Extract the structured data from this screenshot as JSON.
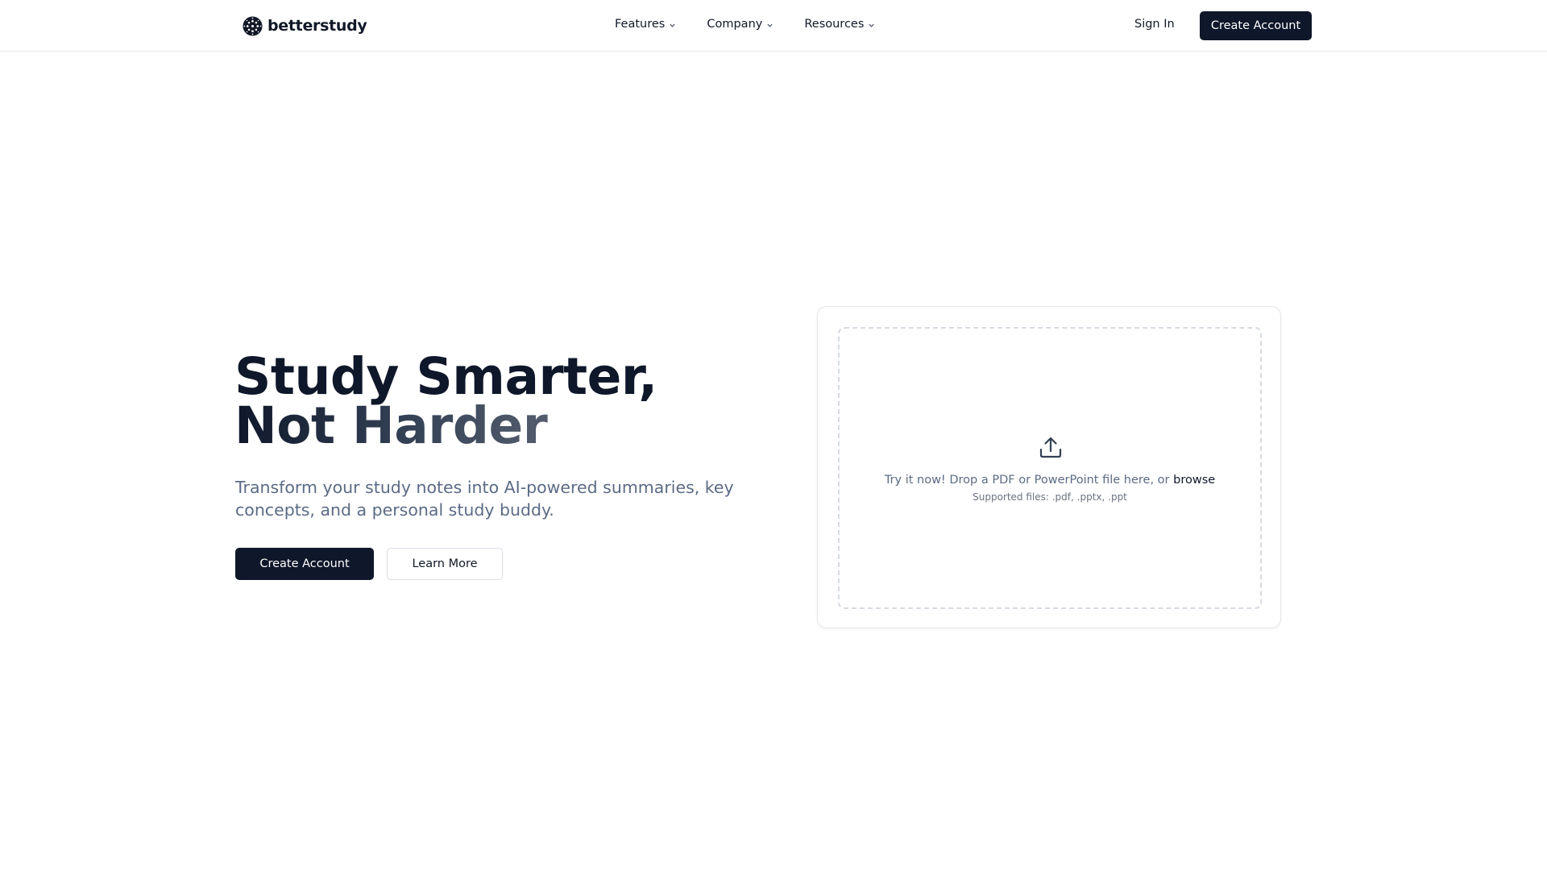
{
  "header": {
    "brand": "betterstudy",
    "nav": [
      {
        "label": "Features"
      },
      {
        "label": "Company"
      },
      {
        "label": "Resources"
      }
    ],
    "sign_in": "Sign In",
    "create_account": "Create Account"
  },
  "hero": {
    "title_line1": "Study Smarter,",
    "title_line2": "Not Harder",
    "subtitle": "Transform your study notes into AI-powered summaries, key concepts, and a personal study buddy.",
    "primary_cta": "Create Account",
    "secondary_cta": "Learn More"
  },
  "upload": {
    "icon": "upload-icon",
    "prompt": "Try it now! Drop a PDF or PowerPoint file here, or",
    "browse": "browse",
    "supported": "Supported files: .pdf, .pptx, .ppt"
  },
  "colors": {
    "primary": "#0f172a",
    "muted_text": "#5b6b85",
    "border": "#e5e7eb"
  }
}
